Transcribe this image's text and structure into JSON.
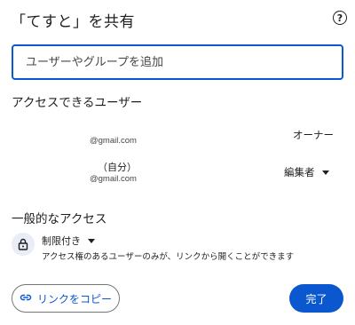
{
  "dialog": {
    "title": "「てすと」を共有",
    "help_glyph": "?"
  },
  "add_people": {
    "placeholder": "ユーザーやグループを追加",
    "value": ""
  },
  "people_section": {
    "heading": "アクセスできるユーザー",
    "people": [
      {
        "name": "",
        "email": "@gmail.com",
        "role": "オーナー"
      },
      {
        "name": "（自分）",
        "email": "@gmail.com",
        "role": "編集者"
      }
    ]
  },
  "general_access": {
    "heading": "一般的なアクセス",
    "level": "制限付き",
    "description": "アクセス権のあるユーザーのみが、リンクから開くことができます"
  },
  "footer": {
    "copy_link_label": "リンクをコピー",
    "done_label": "完了"
  },
  "colors": {
    "accent": "#0b57d0",
    "lock_bg": "#e9eef6",
    "text": "#1f1f1f",
    "secondary_text": "#444746"
  },
  "icons": [
    "help-icon",
    "lock-icon",
    "link-icon",
    "dropdown-caret-icon"
  ]
}
